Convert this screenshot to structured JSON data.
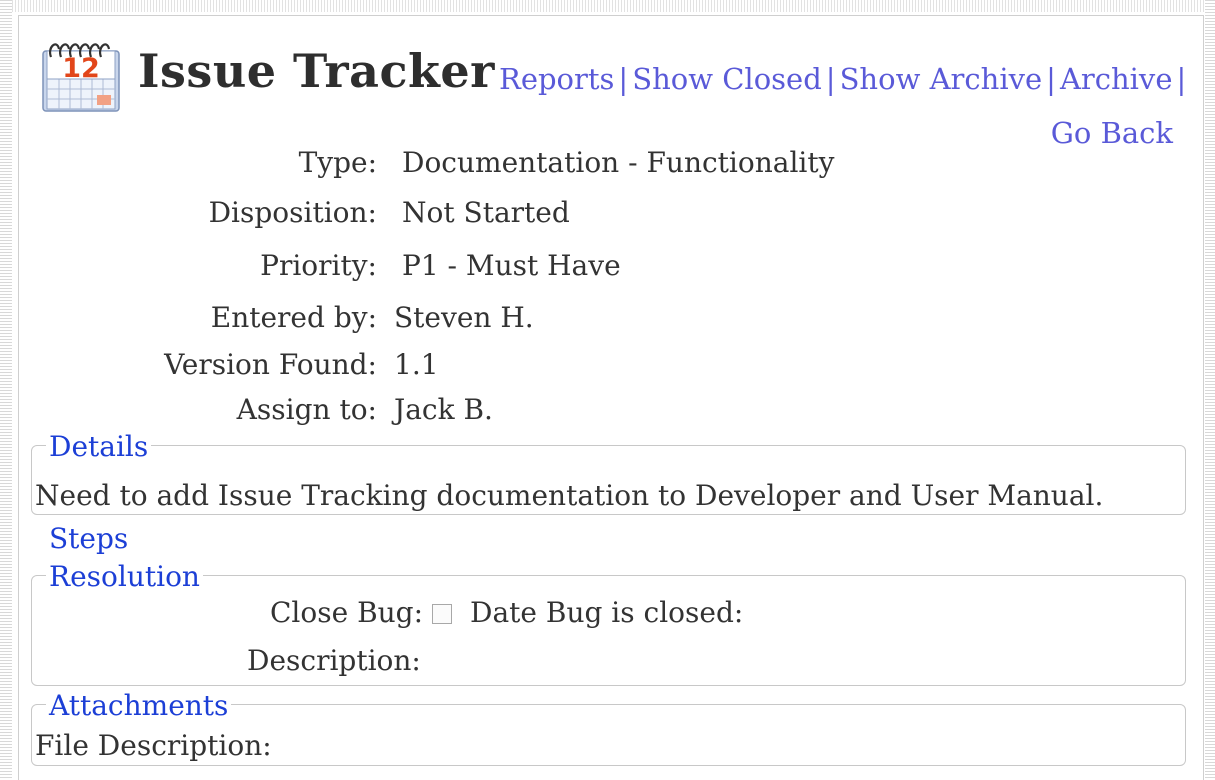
{
  "header": {
    "icon_name": "calendar-icon",
    "calendar_day": "12",
    "title": "Issue Tracker",
    "nav": {
      "reports": "Reports",
      "show_closed": "Show Closed",
      "show_archive": "Show Archive",
      "archive": "Archive",
      "separator": "|",
      "go_back": "Go Back"
    }
  },
  "fields": {
    "type": {
      "label": "Type:",
      "value": "Documentation - Functionality"
    },
    "disposition": {
      "label": "Disposition:",
      "value": "Not Started"
    },
    "priority": {
      "label": "Priority:",
      "value": "P1 - Must Have"
    },
    "entered_by": {
      "label": "Entered by:",
      "value": "Steven H."
    },
    "version_found": {
      "label": "Version Found:",
      "value": "1.1"
    },
    "assign_to": {
      "label": "Assign to:",
      "value": "Jack B."
    }
  },
  "details": {
    "legend": "Details",
    "text": "Need to add Issue Tracking documentation to Developer and User Manual."
  },
  "steps": {
    "legend": "Steps"
  },
  "resolution": {
    "legend": "Resolution",
    "close_bug_label": "Close Bug:",
    "close_bug_checked": false,
    "date_closed_label": "Date Bug is closed:",
    "description_label": "Description:"
  },
  "attachments": {
    "legend": "Attachments",
    "file_description_label": "File Description:"
  },
  "colors": {
    "link": "#5a5ad8",
    "legend": "#1c3fd6",
    "text": "#333333",
    "title": "#2e2e2e",
    "calendar_red": "#e2461a"
  }
}
